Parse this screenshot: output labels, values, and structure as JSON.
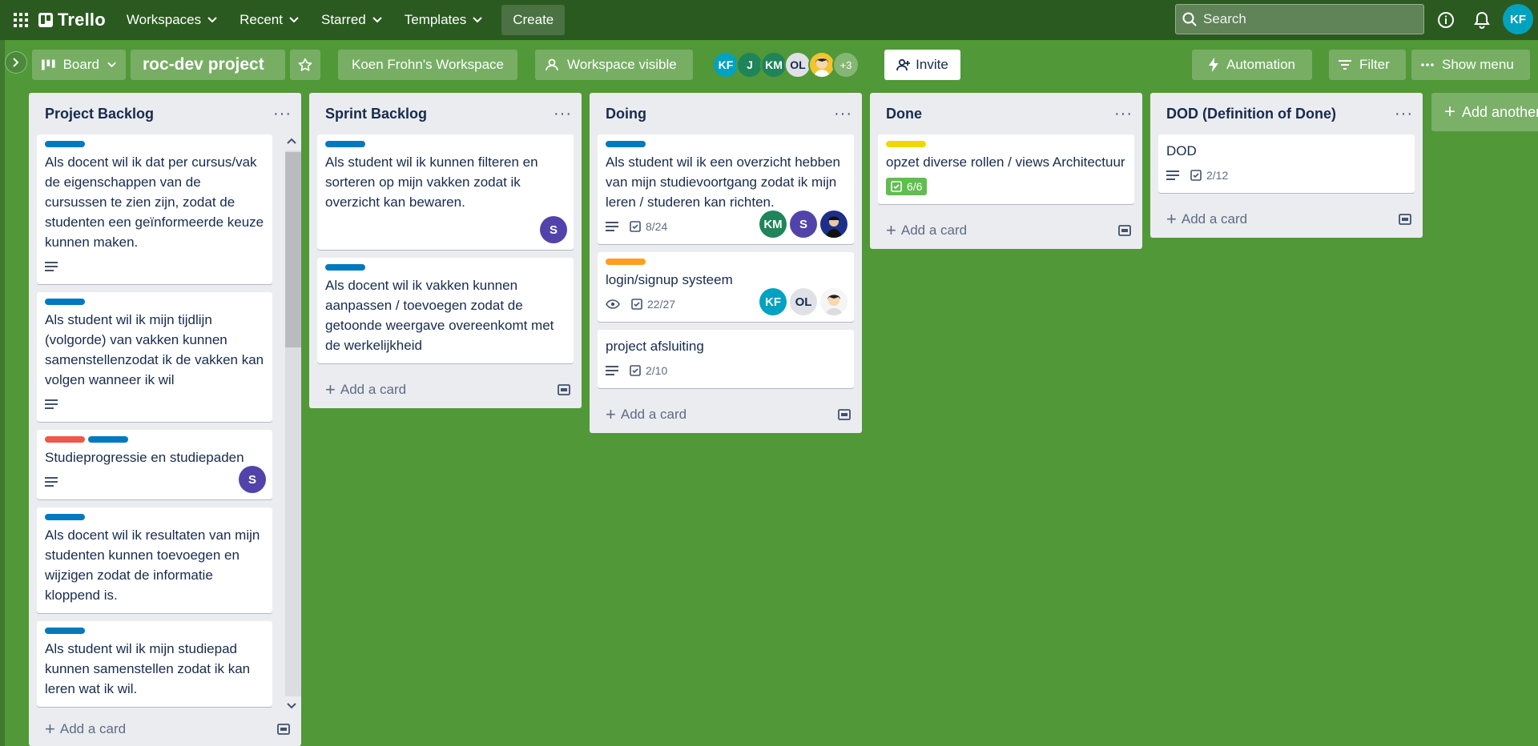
{
  "header": {
    "logo_text": "Trello",
    "nav": [
      "Workspaces",
      "Recent",
      "Starred",
      "Templates"
    ],
    "create_label": "Create",
    "search_placeholder": "Search",
    "user_initials": "KF"
  },
  "board_header": {
    "view_label": "Board",
    "board_title": "roc-dev project",
    "workspace_label": "Koen Frohn's Workspace",
    "visibility_label": "Workspace visible",
    "members": [
      {
        "initials": "KF",
        "color": "#00a3bf"
      },
      {
        "initials": "J",
        "color": "#1f845a"
      },
      {
        "initials": "KM",
        "color": "#1f845a"
      },
      {
        "initials": "OL",
        "color": "#dfe1e6"
      }
    ],
    "extra_members": "+3",
    "invite_label": "Invite",
    "automation_label": "Automation",
    "filter_label": "Filter",
    "show_menu_label": "Show menu"
  },
  "lists": [
    {
      "title": "Project Backlog",
      "cards": [
        {
          "labels": [
            "#0079bf"
          ],
          "title": "Als docent wil ik dat per cursus/vak de eigenschappen van de cursussen te zien zijn, zodat de studenten een geïnformeerde keuze kunnen maken.",
          "description": true
        },
        {
          "labels": [
            "#0079bf"
          ],
          "title": "Als student wil ik mijn tijdlijn (volgorde) van vakken kunnen samenstellenzodat ik de vakken kan volgen wanneer ik wil",
          "description": true
        },
        {
          "labels": [
            "#eb5a46",
            "#0079bf"
          ],
          "title": "Studieprogressie en studiepaden",
          "description": true,
          "members": [
            {
              "initials": "S",
              "color": "#5243aa"
            }
          ]
        },
        {
          "labels": [
            "#0079bf"
          ],
          "title": "Als docent wil ik resultaten van mijn studenten kunnen toevoegen en wijzigen zodat de informatie kloppend is."
        },
        {
          "labels": [
            "#0079bf"
          ],
          "title": "Als student wil ik mijn studiepad kunnen samenstellen zodat ik kan leren wat ik wil."
        }
      ],
      "add_label": "Add a card"
    },
    {
      "title": "Sprint Backlog",
      "cards": [
        {
          "labels": [
            "#0079bf"
          ],
          "title": "Als student wil ik kunnen filteren en sorteren op mijn vakken zodat ik overzicht kan bewaren.",
          "members": [
            {
              "initials": "S",
              "color": "#5243aa"
            }
          ]
        },
        {
          "labels": [
            "#0079bf"
          ],
          "title": "Als docent wil ik vakken kunnen aanpassen / toevoegen zodat de getoonde weergave overeenkomt met de werkelijkheid"
        }
      ],
      "add_label": "Add a card"
    },
    {
      "title": "Doing",
      "cards": [
        {
          "labels": [
            "#0079bf"
          ],
          "title": "Als student wil ik een overzicht hebben van mijn studievoortgang zodat ik mijn leren / studeren kan richten.",
          "description": true,
          "checklist": "8/24",
          "members": [
            {
              "initials": "KM",
              "color": "#1f845a"
            },
            {
              "initials": "S",
              "color": "#5243aa"
            },
            {
              "initials": "",
              "color": "#1d2f8a",
              "photo": true
            }
          ]
        },
        {
          "labels": [
            "#ff9f1a"
          ],
          "title": "login/signup systeem",
          "watch": true,
          "checklist": "22/27",
          "members": [
            {
              "initials": "KF",
              "color": "#00a3bf"
            },
            {
              "initials": "OL",
              "color": "#dfe1e6"
            },
            {
              "initials": "",
              "color": "#f5f5f5",
              "photo": true
            }
          ]
        },
        {
          "labels": [],
          "title": "project afsluiting",
          "description": true,
          "checklist": "2/10"
        }
      ],
      "add_label": "Add a card"
    },
    {
      "title": "Done",
      "cards": [
        {
          "labels": [
            "#f2d600"
          ],
          "title": "opzet diverse rollen / views Architectuur",
          "checklist_done": "6/6"
        }
      ],
      "add_label": "Add a card"
    },
    {
      "title": "DOD (Definition of Done)",
      "cards": [
        {
          "labels": [],
          "title": "DOD",
          "description": true,
          "checklist": "2/12"
        }
      ],
      "add_label": "Add a card"
    }
  ],
  "add_list_label": "Add another list"
}
